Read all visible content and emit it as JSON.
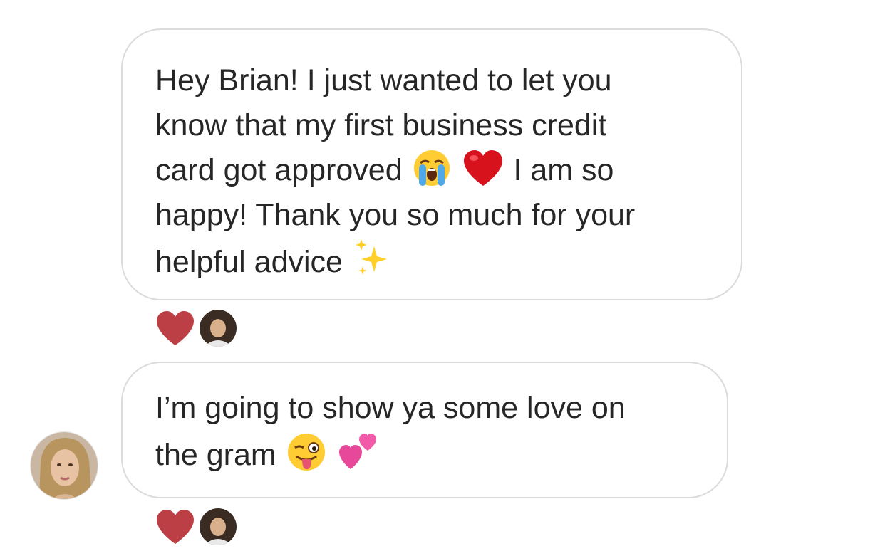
{
  "messages": [
    {
      "lines": [
        {
          "text": "Hey Brian! I just wanted to let you"
        },
        {
          "text": "know that my first business credit"
        },
        {
          "pre": "card got approved",
          "post": "I am so"
        },
        {
          "text": "happy! Thank you so much for your"
        },
        {
          "text": "helpful advice"
        }
      ],
      "emojis": [
        "crying-face-emoji",
        "red-heart-emoji",
        "sparkles-emoji"
      ],
      "reaction": {
        "icon": "heart-icon",
        "color": "#bc3f45"
      }
    },
    {
      "lines": [
        {
          "text": "I’m going to show ya some love on"
        },
        {
          "text": "the gram"
        }
      ],
      "emojis": [
        "winking-tongue-face-emoji",
        "two-hearts-emoji"
      ],
      "reaction": {
        "icon": "heart-icon",
        "color": "#bc3f45"
      }
    }
  ],
  "colors": {
    "bubble_border": "#dbdbdb",
    "text": "#262626",
    "reaction_heart": "#bc3f45",
    "background": "#ffffff"
  }
}
